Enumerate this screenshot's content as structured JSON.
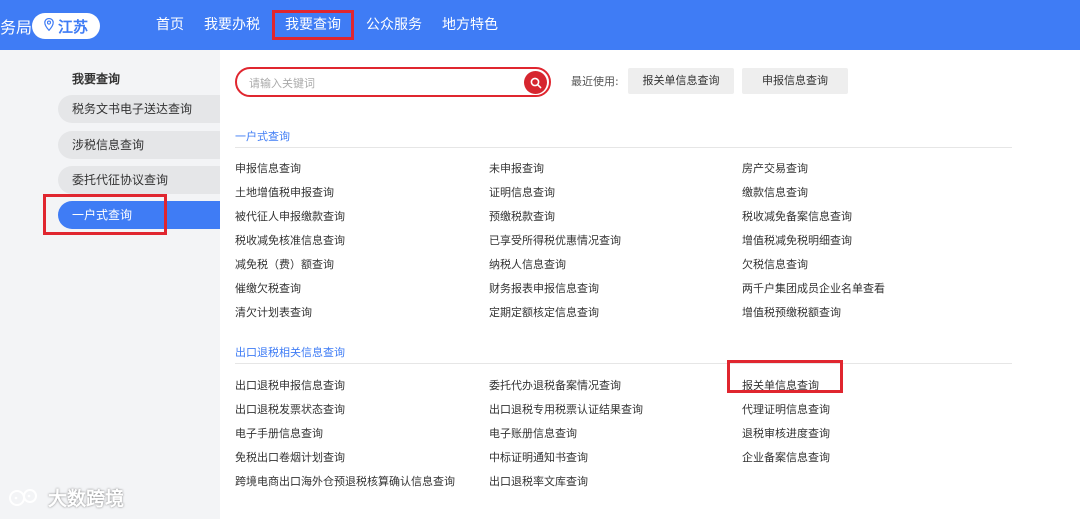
{
  "header": {
    "brand": "务局",
    "region": "江苏",
    "nav": [
      "首页",
      "我要办税",
      "我要查询",
      "公众服务",
      "地方特色"
    ],
    "active_nav_index": 2
  },
  "sidebar": {
    "title": "我要查询",
    "items": [
      "税务文书电子送达查询",
      "涉税信息查询",
      "委托代征协议查询",
      "一户式查询"
    ],
    "active_index": 3
  },
  "search": {
    "placeholder": "请输入关键词",
    "recent_label": "最近使用:",
    "recent": [
      "报关单信息查询",
      "申报信息查询"
    ]
  },
  "sections": [
    {
      "title": "一户式查询",
      "columns": [
        [
          "申报信息查询",
          "土地增值税申报查询",
          "被代征人申报缴款查询",
          "税收减免核准信息查询",
          "减免税（费）额查询",
          "催缴欠税查询",
          "清欠计划表查询"
        ],
        [
          "未申报查询",
          "证明信息查询",
          "预缴税款查询",
          "已享受所得税优惠情况查询",
          "纳税人信息查询",
          "财务报表申报信息查询",
          "定期定额核定信息查询"
        ],
        [
          "房产交易查询",
          "缴款信息查询",
          "税收减免备案信息查询",
          "增值税减免税明细查询",
          "欠税信息查询",
          "两千户集团成员企业名单查看",
          "增值税预缴税额查询"
        ]
      ]
    },
    {
      "title": "出口退税相关信息查询",
      "columns": [
        [
          "出口退税申报信息查询",
          "出口退税发票状态查询",
          "电子手册信息查询",
          "免税出口卷烟计划查询",
          "跨境电商出口海外仓预退税核算确认信息查询"
        ],
        [
          "委托代办退税备案情况查询",
          "出口退税专用税票认证结果查询",
          "电子账册信息查询",
          "中标证明通知书查询",
          "出口退税率文库查询"
        ],
        [
          "报关单信息查询",
          "代理证明信息查询",
          "退税审核进度查询",
          "企业备案信息查询"
        ]
      ]
    }
  ],
  "watermark": "大数跨境",
  "colors": {
    "primary": "#3f7cf5",
    "highlight": "#e0262f",
    "search_button": "#d6262f"
  }
}
